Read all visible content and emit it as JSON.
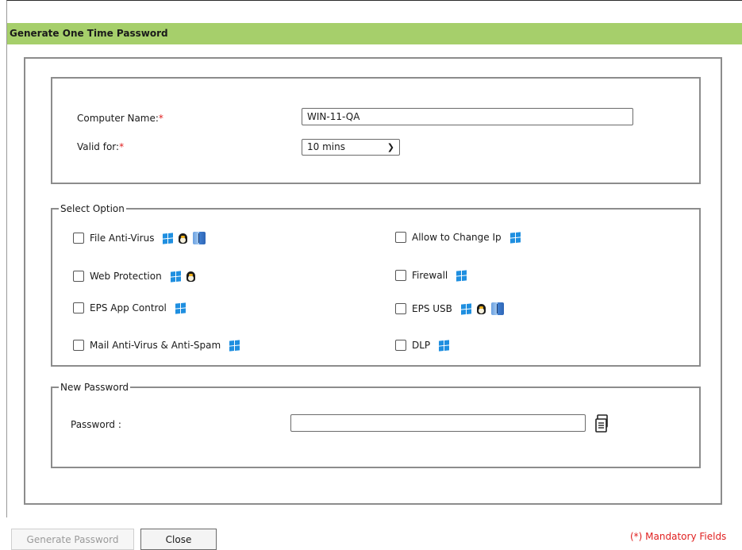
{
  "dialog": {
    "title": "Generate One Time Password"
  },
  "form": {
    "computer_name_label": "Computer Name:",
    "computer_name_value": "WIN-11-QA",
    "valid_for_label": "Valid for:",
    "valid_for_value": "10 mins",
    "required_marker": "*"
  },
  "options": {
    "legend": "Select Option",
    "items": [
      {
        "label": "File Anti-Virus",
        "icons": [
          "windows-icon",
          "linux-icon",
          "mac-icon"
        ]
      },
      {
        "label": "Web Protection",
        "icons": [
          "windows-icon",
          "linux-icon"
        ]
      },
      {
        "label": "EPS App Control",
        "icons": [
          "windows-icon"
        ]
      },
      {
        "label": "Mail Anti-Virus & Anti-Spam",
        "icons": [
          "windows-icon"
        ]
      },
      {
        "label": "Allow to Change Ip",
        "icons": [
          "windows-icon"
        ]
      },
      {
        "label": "Firewall",
        "icons": [
          "windows-icon"
        ]
      },
      {
        "label": "EPS USB",
        "icons": [
          "windows-icon",
          "linux-icon",
          "mac-icon"
        ]
      },
      {
        "label": "DLP",
        "icons": [
          "windows-icon"
        ]
      }
    ]
  },
  "new_password": {
    "legend": "New Password",
    "label": "Password :",
    "value": ""
  },
  "footer": {
    "generate_label": "Generate Password",
    "close_label": "Close",
    "mandatory_note": "(*) Mandatory Fields"
  },
  "colors": {
    "title_bar": "#a6cf6b",
    "required": "#e02020",
    "windows_icon": "#1f8fe0"
  }
}
